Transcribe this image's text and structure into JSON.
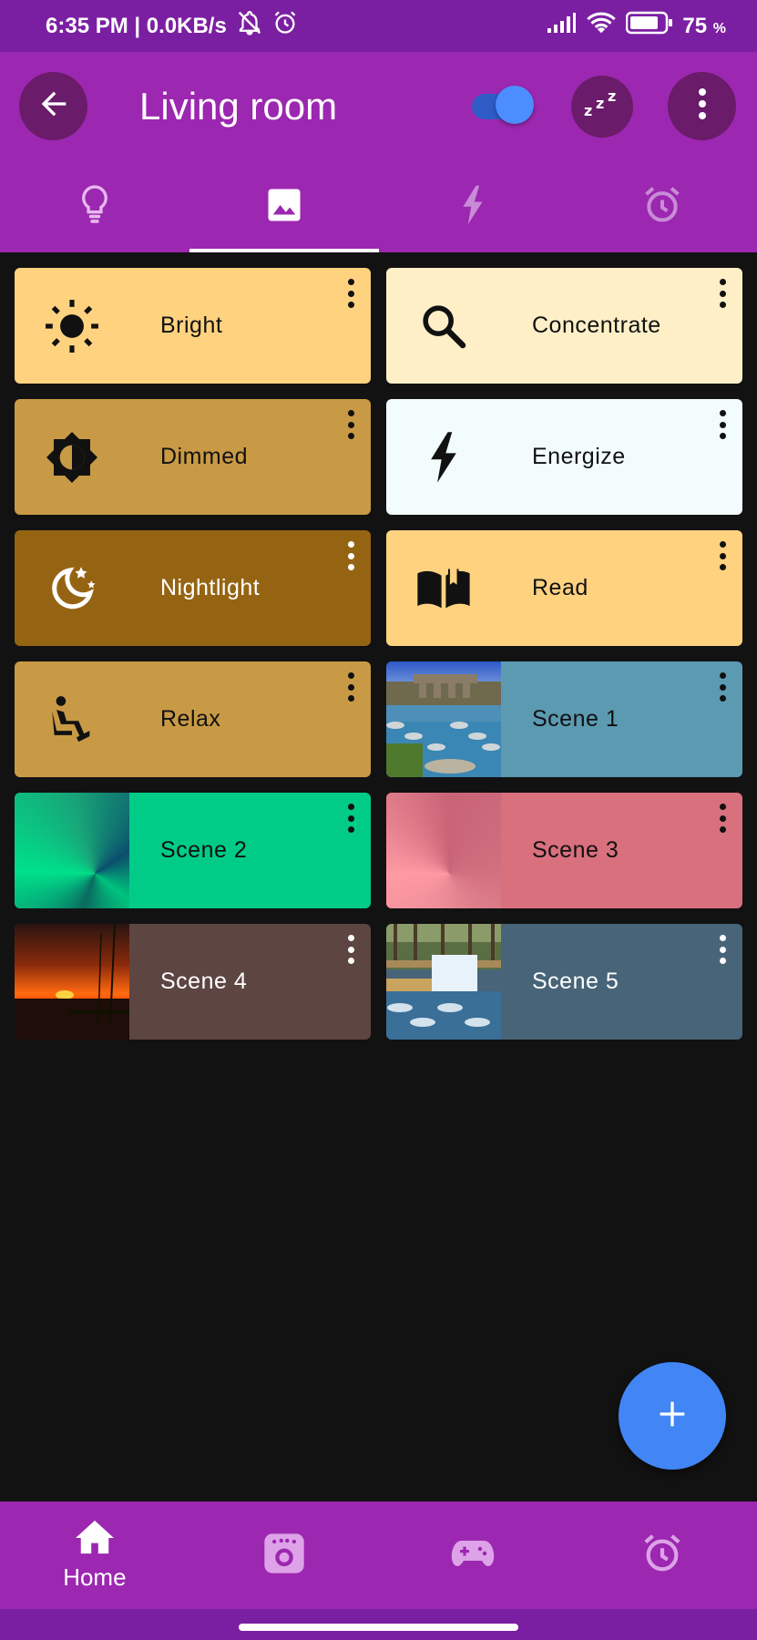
{
  "status_bar": {
    "time_network": "6:35 PM | 0.0KB/s",
    "battery": "75",
    "battery_unit": "%"
  },
  "app_bar": {
    "title": "Living room",
    "power_on": true
  },
  "tabs": [
    {
      "icon": "lightbulb-icon",
      "active": false
    },
    {
      "icon": "image-icon",
      "active": true
    },
    {
      "icon": "flash-icon",
      "active": false
    },
    {
      "icon": "alarm-icon",
      "active": false
    }
  ],
  "scenes": [
    {
      "label": "Bright",
      "icon": "sun-icon",
      "bg": "#FFD27F",
      "fg": "#111111"
    },
    {
      "label": "Concentrate",
      "icon": "search-icon",
      "bg": "#FFEFC7",
      "fg": "#111111"
    },
    {
      "label": "Dimmed",
      "icon": "brightness-icon",
      "bg": "#C99A45",
      "fg": "#111111"
    },
    {
      "label": "Energize",
      "icon": "bolt-icon",
      "bg": "#F2FCFC",
      "fg": "#111111"
    },
    {
      "label": "Nightlight",
      "icon": "moon-stars-icon",
      "bg": "#956413",
      "fg": "#FFFFFF"
    },
    {
      "label": "Read",
      "icon": "book-icon",
      "bg": "#FFD27F",
      "fg": "#111111"
    },
    {
      "label": "Relax",
      "icon": "recline-icon",
      "bg": "#C99A45",
      "fg": "#111111"
    },
    {
      "label": "Scene 1",
      "icon": "river-photo",
      "bg": "#5C9AB2",
      "fg": "#111111"
    },
    {
      "label": "Scene 2",
      "icon": "green-gradient",
      "bg": "#00CC88",
      "fg": "#111111"
    },
    {
      "label": "Scene 3",
      "icon": "pink-gradient",
      "bg": "#D9707E",
      "fg": "#111111"
    },
    {
      "label": "Scene 4",
      "icon": "sunset-photo",
      "bg": "#5D4542",
      "fg": "#FFFFFF"
    },
    {
      "label": "Scene 5",
      "icon": "waterfall-photo",
      "bg": "#486478",
      "fg": "#FFFFFF"
    }
  ],
  "bottom_nav": {
    "home_label": "Home"
  },
  "colors": {
    "primary": "#9C27B0",
    "status_bar": "#7B1FA2",
    "fab": "#4285F4",
    "background": "#121212"
  }
}
